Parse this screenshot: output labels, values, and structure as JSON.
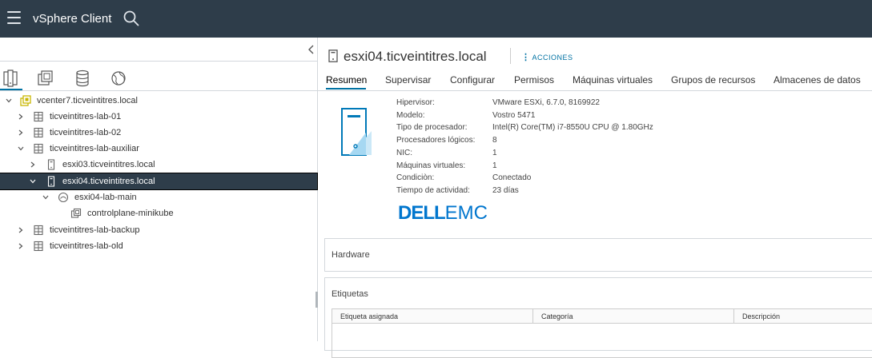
{
  "app": {
    "title": "vSphere Client"
  },
  "colors": {
    "topbar": "#2e3d4a",
    "accent": "#0072a3",
    "vcenter": "#c8b600",
    "selected": "#2e3d4a",
    "dell": "#0076ce"
  },
  "views": [
    "hosts-clusters-icon",
    "vms-templates-icon",
    "storage-icon",
    "networking-icon"
  ],
  "tree": [
    {
      "label": "vcenter7.ticveintitres.local",
      "icon": "vcenter-icon",
      "expanded": true
    },
    {
      "label": "ticveintitres-lab-01",
      "icon": "datacenter-icon",
      "expanded": false
    },
    {
      "label": "ticveintitres-lab-02",
      "icon": "datacenter-icon",
      "expanded": false
    },
    {
      "label": "ticveintitres-lab-auxiliar",
      "icon": "datacenter-icon",
      "expanded": true
    },
    {
      "label": "esxi03.ticveintitres.local",
      "icon": "host-icon",
      "expanded": false
    },
    {
      "label": "esxi04.ticveintitres.local",
      "icon": "host-icon",
      "expanded": true,
      "selected": true
    },
    {
      "label": "esxi04-lab-main",
      "icon": "resource-pool-icon",
      "expanded": true
    },
    {
      "label": "controlplane-minikube",
      "icon": "vm-icon"
    },
    {
      "label": "ticveintitres-lab-backup",
      "icon": "datacenter-icon",
      "expanded": false
    },
    {
      "label": "ticveintitres-lab-old",
      "icon": "datacenter-icon",
      "expanded": false
    }
  ],
  "main": {
    "title": "esxi04.ticveintitres.local",
    "actions_label": "ACCIONES",
    "tabs": [
      "Resumen",
      "Supervisar",
      "Configurar",
      "Permisos",
      "Máquinas virtuales",
      "Grupos de recursos",
      "Almacenes de datos"
    ],
    "active_tab": "Resumen",
    "summary": [
      {
        "key": "Hipervisor:",
        "value": "VMware ESXi, 6.7.0, 8169922"
      },
      {
        "key": "Modelo:",
        "value": "Vostro 5471"
      },
      {
        "key": "Tipo de procesador:",
        "value": "Intel(R) Core(TM) i7-8550U CPU @ 1.80GHz"
      },
      {
        "key": "Procesadores lógicos:",
        "value": "8"
      },
      {
        "key": "NIC:",
        "value": "1"
      },
      {
        "key": "Máquinas virtuales:",
        "value": "1"
      },
      {
        "key": "Condiciòn:",
        "value": "Conectado"
      },
      {
        "key": "Tiempo de actividad:",
        "value": "23 días"
      }
    ],
    "vendor_logo": {
      "bold": "DELL",
      "light": "EMC"
    },
    "hardware_title": "Hardware",
    "tags_title": "Etiquetas",
    "tags_columns": [
      "Etiqueta asignada",
      "Categoría",
      "Descripción"
    ]
  }
}
